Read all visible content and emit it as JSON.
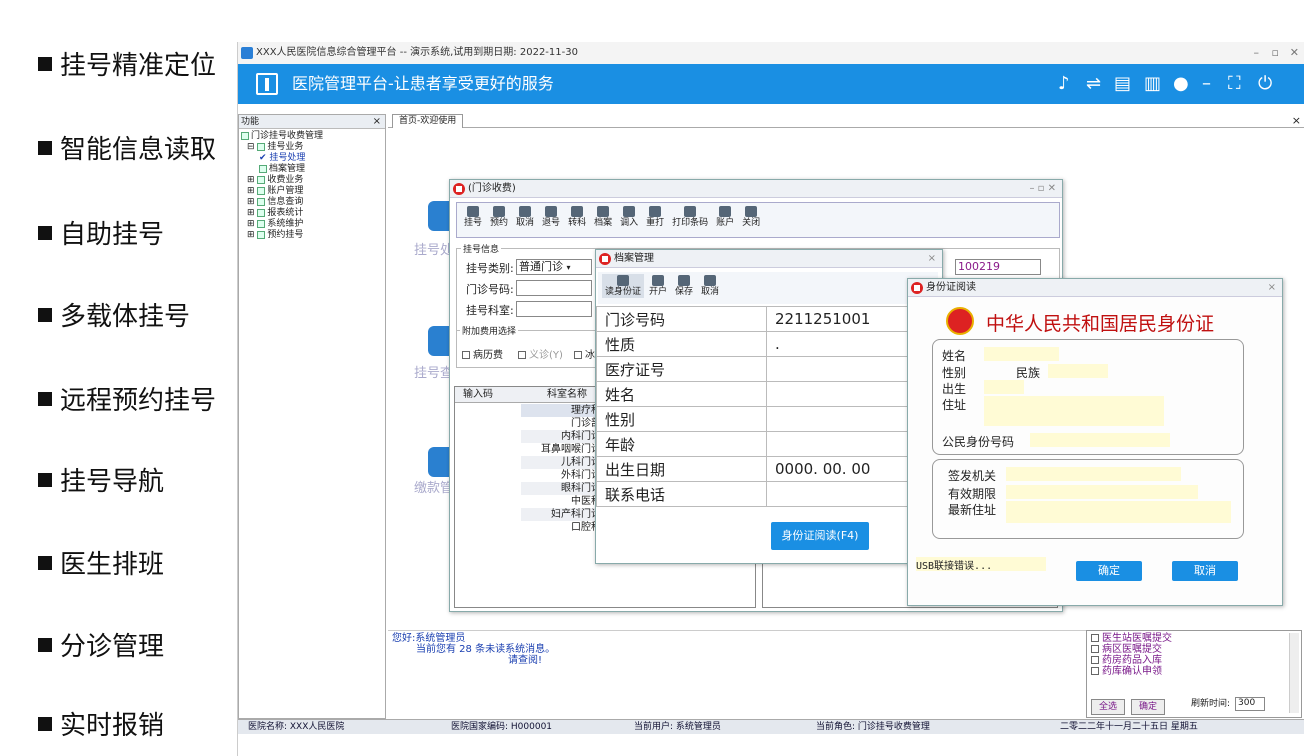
{
  "features": [
    "挂号精准定位",
    "智能信息读取",
    "自助挂号",
    "多载体挂号",
    "远程预约挂号",
    "挂号导航",
    "医生排班",
    "分诊管理",
    "实时报销"
  ],
  "titlebar": {
    "text": "XXX人民医院信息综合管理平台 -- 演示系统,试用到期日期: 2022-11-30",
    "min": "–",
    "max": "▫",
    "close": "✕"
  },
  "header": {
    "title": "医院管理平台-让患者享受更好的服务",
    "icons": [
      "♪",
      "⇌",
      "▤",
      "▥",
      "●",
      "–",
      "⛶",
      "⏻"
    ]
  },
  "left_panel": {
    "title": "功能",
    "close": "×",
    "tree": [
      {
        "label": "门诊挂号收费管理",
        "level": 0
      },
      {
        "label": "挂号业务",
        "level": 1
      },
      {
        "label": "挂号处理",
        "level": 2,
        "check": "✔"
      },
      {
        "label": "档案管理",
        "level": 2
      },
      {
        "label": "收费业务",
        "level": 1
      },
      {
        "label": "账户管理",
        "level": 1
      },
      {
        "label": "信息查询",
        "level": 1
      },
      {
        "label": "报表统计",
        "level": 1
      },
      {
        "label": "系统维护",
        "level": 1
      },
      {
        "label": "预约挂号",
        "level": 1
      }
    ]
  },
  "tab": {
    "label": "首页-欢迎使用",
    "close": "×"
  },
  "bg_labels": [
    "挂号处",
    "挂号查",
    "缴款管"
  ],
  "charge_window": {
    "title": "(门诊收费)",
    "ctrl": "–  ▫  ✕",
    "toolbar": [
      "挂号",
      "预约",
      "取消",
      "退号",
      "转科",
      "档案",
      "调入",
      "重打",
      "打印条码",
      "账户",
      "关闭"
    ],
    "section": "挂号信息",
    "type_label": "挂号类别:",
    "type_value": "普通门诊",
    "clinic_no_label": "门诊号码:",
    "dept_label": "挂号科室:",
    "extra_label": "附加费用选择",
    "extras": [
      "病历费",
      "义诊(Y)",
      "冰"
    ],
    "right_value": "100219",
    "grid_headers": [
      "输入码",
      "科室名称"
    ],
    "depts": [
      "理疗科",
      "门诊部",
      "内科门诊",
      "耳鼻咽喉门诊",
      "儿科门诊",
      "外科门诊",
      "眼科门诊",
      "中医科",
      "妇产科门诊",
      "口腔科"
    ]
  },
  "archive_window": {
    "title": "档案管理",
    "close": "×",
    "toolbar": [
      "读身份证",
      "开户",
      "保存",
      "取消"
    ],
    "rows": [
      {
        "label": "门诊号码",
        "value": "2211251001"
      },
      {
        "label": "性质",
        "value": "."
      },
      {
        "label": "医疗证号",
        "value": ""
      },
      {
        "label": "姓名",
        "value": ""
      },
      {
        "label": "性别",
        "value": ""
      },
      {
        "label": "年龄",
        "value": ""
      },
      {
        "label": "出生日期",
        "value": "0000. 00. 00"
      },
      {
        "label": "联系电话",
        "value": ""
      }
    ],
    "read_button": "身份证阅读(F4)"
  },
  "idcard_window": {
    "title": "身份证阅读",
    "close": "×",
    "heading": "中华人民共和国居民身份证",
    "fields": [
      "姓名",
      "性别",
      "民族",
      "出生",
      "住址",
      "公民身份号码"
    ],
    "fields2": [
      "签发机关",
      "有效期限",
      "最新住址"
    ],
    "status": "USB联接错误...",
    "ok": "确定",
    "cancel": "取消"
  },
  "messages": {
    "line1": "您好:系统管理员",
    "line2": "当前您有  28  条未读系统消息。",
    "line3": "请查阅!"
  },
  "notices": {
    "items": [
      "医生站医嘱提交",
      "病区医嘱提交",
      "药房药品入库",
      "药库确认申领"
    ],
    "select_all": "全选",
    "confirm": "确定",
    "refresh_label": "刷新时间:",
    "refresh_value": "300"
  },
  "statusbar": {
    "hospital": "医院名称: XXX人民医院",
    "code": "医院国家编码: H000001",
    "user": "当前用户: 系统管理员",
    "role": "当前角色: 门诊挂号收费管理",
    "date": "二零二二年十一月二十五日 星期五"
  },
  "colors": {
    "brand": "#1a8fe3",
    "danger": "#d22"
  }
}
